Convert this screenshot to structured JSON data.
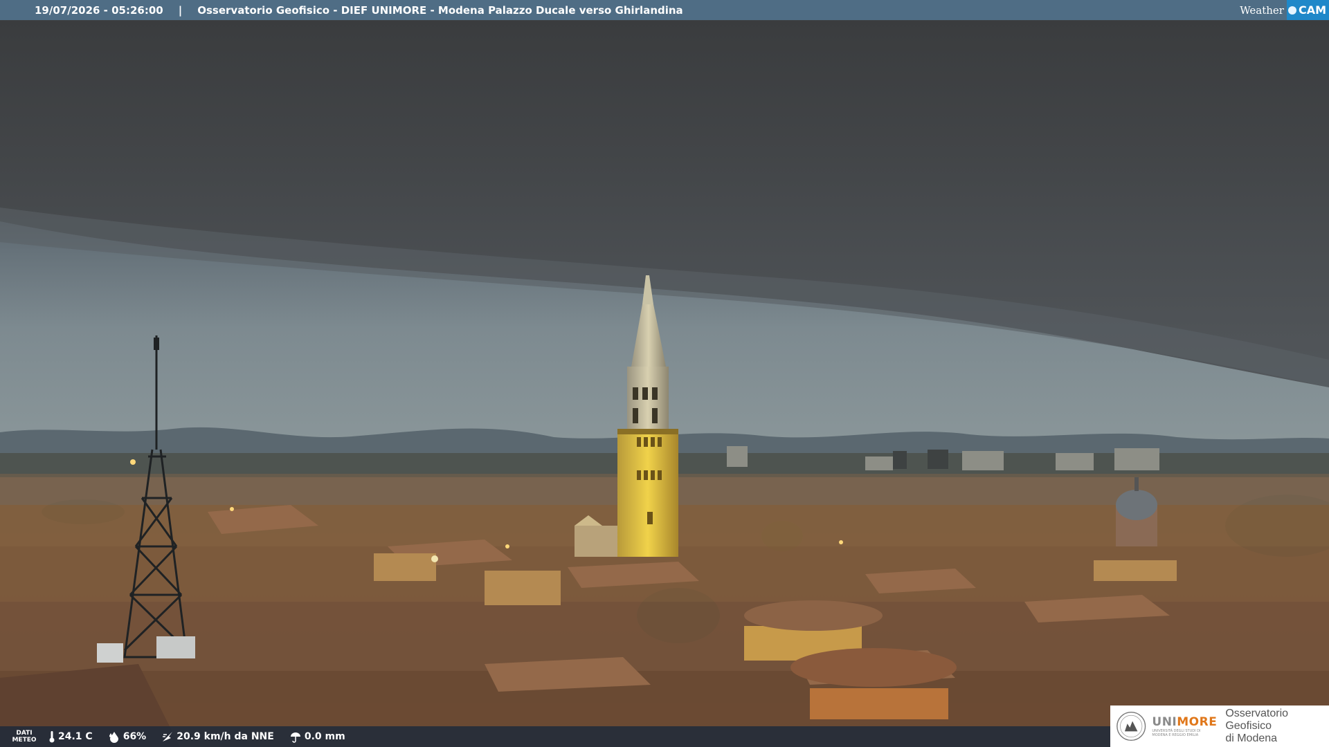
{
  "header": {
    "datetime": "19/07/2026 - 05:26:00",
    "separator": "|",
    "title": "Osservatorio Geofisico - DIEF UNIMORE - Modena Palazzo Ducale verso Ghirlandina",
    "brand_left": "Weather",
    "brand_right": "CAM"
  },
  "weather": {
    "label_line1": "DATI",
    "label_line2": "METEO",
    "temperature": "24.1 C",
    "humidity": "66%",
    "wind": "20.9 km/h da NNE",
    "rain": "0.0 mm"
  },
  "logo": {
    "university": "UNIMORE",
    "university_highlight": "MORE",
    "university_prefix": "UNI",
    "university_sub_line1": "UNIVERSITÀ DEGLI STUDI DI",
    "university_sub_line2": "MODENA E REGGIO EMILIA",
    "observatory_line1": "Osservatorio Geofisico",
    "observatory_line2": "di Modena"
  },
  "colors": {
    "topbar": "#4f6d85",
    "brand_accent": "#1f88c9",
    "tower_lit": "#d9b23a",
    "roofs": "#8a5a3a",
    "sky": "#6e7a80"
  },
  "icons": [
    "thermometer-icon",
    "humidity-icon",
    "wind-icon",
    "rain-icon",
    "weathercam-logo-icon",
    "university-seal-icon"
  ]
}
